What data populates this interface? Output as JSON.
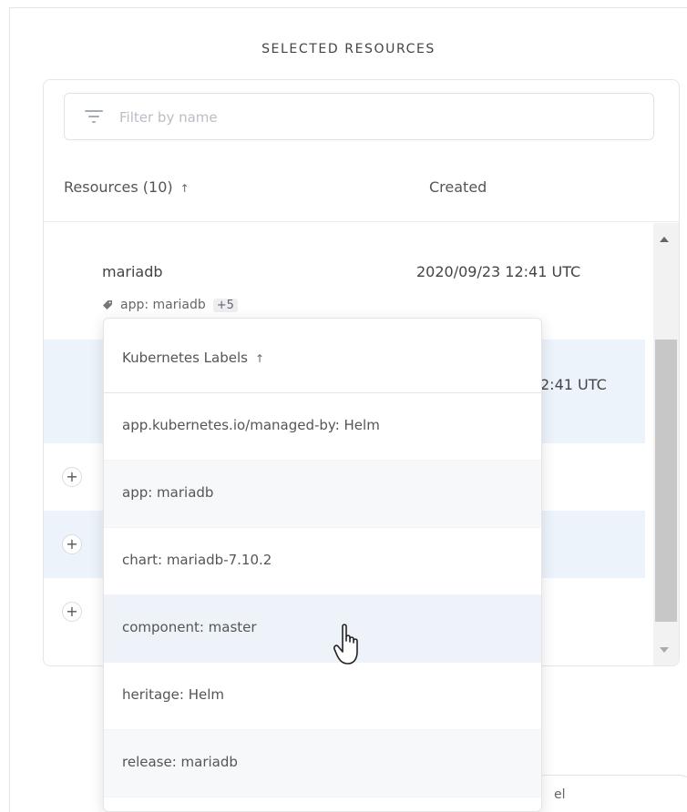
{
  "panel": {
    "title": "SELECTED RESOURCES"
  },
  "filter": {
    "placeholder": "Filter by name"
  },
  "table": {
    "columns": {
      "resources": "Resources (10)",
      "created": "Created",
      "sort_arrow": "↑"
    },
    "rows": [
      {
        "name": "mariadb",
        "created": "2020/09/23 12:41 UTC",
        "tag": "app: mariadb",
        "more": "+5"
      },
      {
        "created_partial": "2:41 UTC"
      }
    ],
    "expand_symbol": "+"
  },
  "labels_menu": {
    "header": "Kubernetes Labels",
    "sort_arrow": "↑",
    "items": [
      "app.kubernetes.io/managed-by: Helm",
      "app: mariadb",
      "chart: mariadb-7.10.2",
      "component: master",
      "heritage: Helm",
      "release: mariadb"
    ],
    "hovered_index": 3
  },
  "bottom_field": {
    "partial_text": "el"
  },
  "icons": {
    "filter": "filter-icon",
    "tag": "tag-icon",
    "cursor": "hand-cursor-icon"
  },
  "colors": {
    "row_highlight": "#edf3fb",
    "scroll_thumb": "#c7c7c7"
  }
}
